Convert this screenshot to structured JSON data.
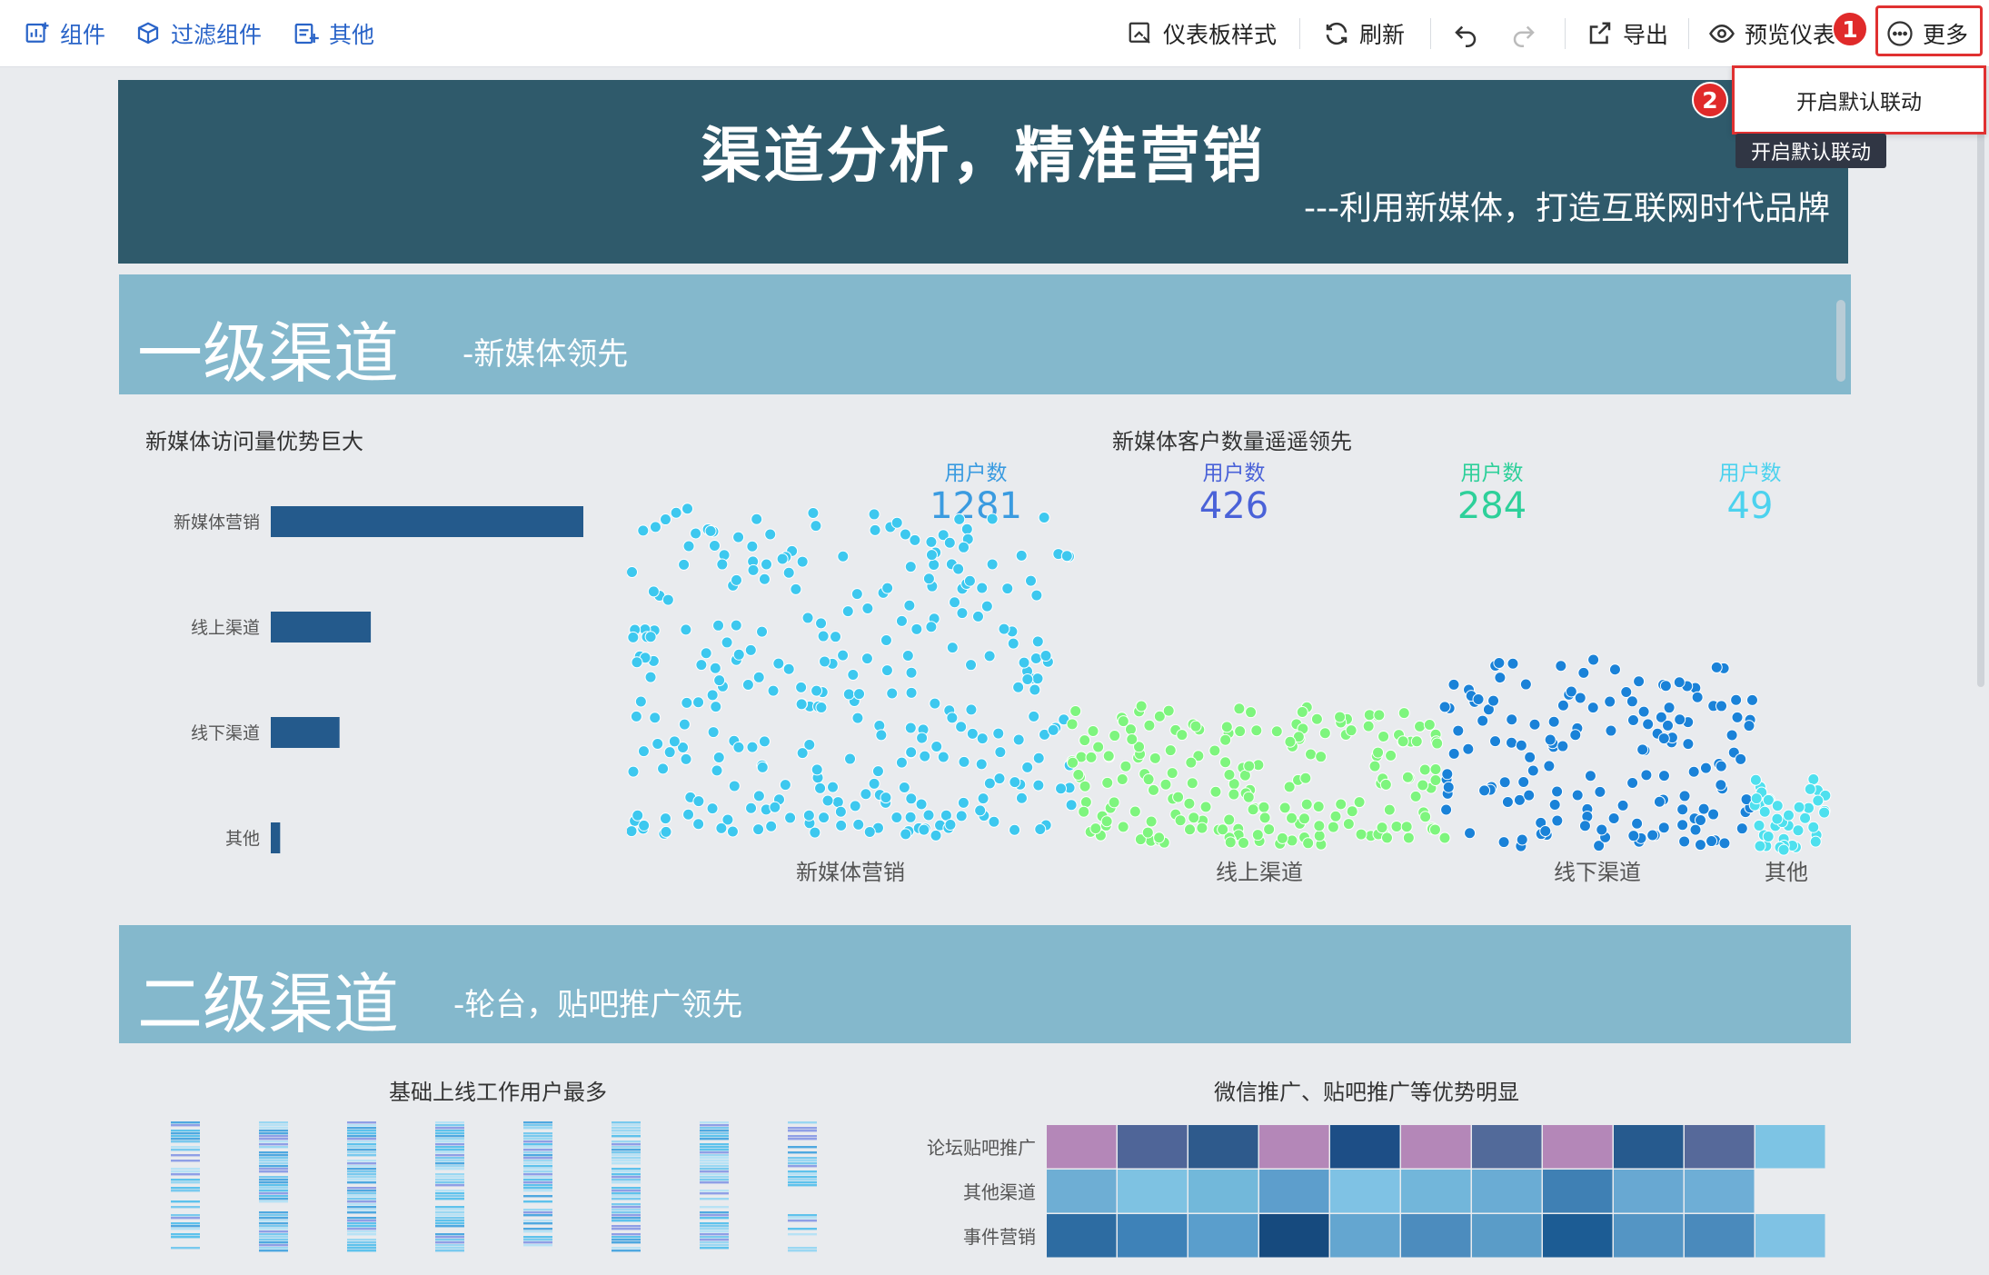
{
  "toolbar": {
    "left": [
      {
        "label": "组件",
        "icon": "add-chart-icon"
      },
      {
        "label": "过滤组件",
        "icon": "filter-cube-icon"
      },
      {
        "label": "其他",
        "icon": "other-add-icon"
      }
    ],
    "dashboard_style": "仪表板样式",
    "refresh": "刷新",
    "export": "导出",
    "preview": "预览仪表",
    "more": "更多"
  },
  "annotations": {
    "badge1": "1",
    "badge2": "2"
  },
  "dropdown": {
    "item": "开启默认联动"
  },
  "tooltip": "开启默认联动",
  "banner": {
    "title": "渠道分析，精准营销",
    "subtitle": "---利用新媒体，打造互联网时代品牌"
  },
  "section1": {
    "title": "一级渠道",
    "subtitle": "-新媒体领先"
  },
  "section2": {
    "title": "二级渠道",
    "subtitle": "-轮台，贴吧推广领先"
  },
  "colors": {
    "banner": "#2f5a6b",
    "section": "#84b8cc",
    "bar": "#245a8c",
    "new_media": "#3dc8ef",
    "online": "#7ef57e",
    "offline": "#1a82d8",
    "other": "#4ee0ee"
  },
  "chart_data": [
    {
      "type": "bar",
      "title": "新媒体访问量优势巨大",
      "categories": [
        "新媒体营销",
        "线上渠道",
        "线下渠道",
        "其他"
      ],
      "values": [
        100,
        32,
        22,
        3
      ],
      "orientation": "horizontal"
    },
    {
      "type": "scatter",
      "title": "新媒体客户数量遥遥领先",
      "kpis": [
        {
          "label": "用户数",
          "value": "1281",
          "color": "#3a9be0"
        },
        {
          "label": "用户数",
          "value": "426",
          "color": "#4a62d8"
        },
        {
          "label": "用户数",
          "value": "284",
          "color": "#2ed09a"
        },
        {
          "label": "用户数",
          "value": "49",
          "color": "#4cd2ee"
        }
      ],
      "categories": [
        "新媒体营销",
        "线上渠道",
        "线下渠道",
        "其他"
      ],
      "point_counts": [
        300,
        200,
        150,
        40
      ]
    },
    {
      "type": "heatmap",
      "title": "基础上线工作用户最多",
      "columns": 8
    },
    {
      "type": "heatmap",
      "title": "微信推广、贴吧推广等优势明显",
      "rows": [
        "论坛贴吧推广",
        "其他渠道",
        "事件营销"
      ],
      "cells": [
        [
          "#b487b8",
          "#4f6598",
          "#2e5a8c",
          "#b487b8",
          "#1d4e86",
          "#b487b8",
          "#526a9a",
          "#b487b8",
          "#265a8e",
          "#56699a",
          "#7dc4e4"
        ],
        [
          "#6eaed4",
          "#7ec2e2",
          "#72b8da",
          "#5d9ecc",
          "#7fc2e4",
          "#72b6da",
          "#6aacd4",
          "#3f80b4",
          "#68a8d2",
          "#6eaed6",
          ""
        ],
        [
          "#2d6ca2",
          "#3e82b8",
          "#5a9ecc",
          "#164a7e",
          "#64a6d0",
          "#4c8cbe",
          "#5a9cc8",
          "#1c5c94",
          "#5495c4",
          "#4a8abc",
          "#7fc2e4"
        ]
      ]
    }
  ]
}
